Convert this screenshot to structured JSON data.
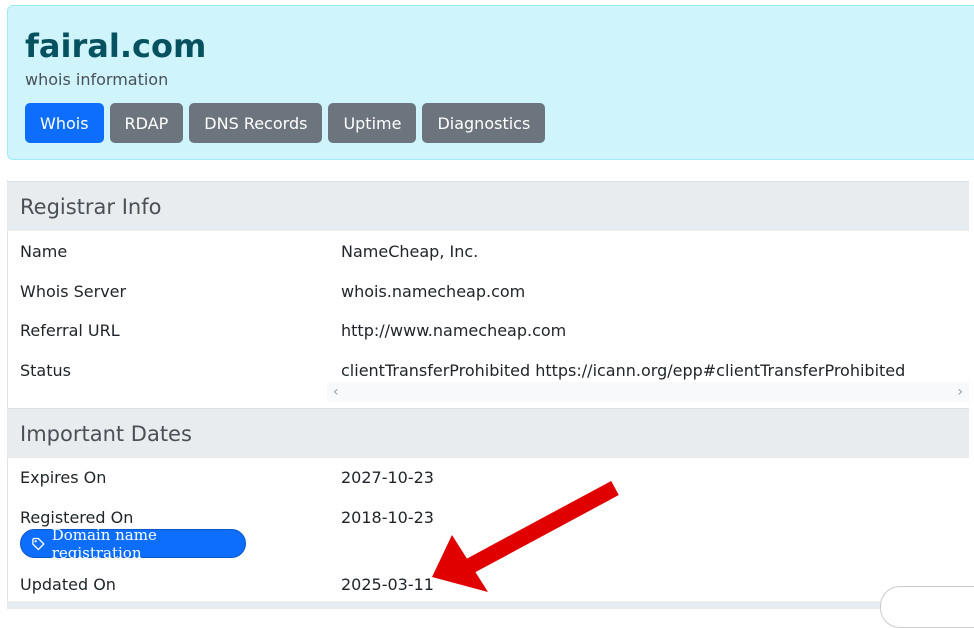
{
  "header": {
    "domain": "fairal.com",
    "subtitle": "whois information",
    "tabs": [
      {
        "label": "Whois",
        "active": true
      },
      {
        "label": "RDAP",
        "active": false
      },
      {
        "label": "DNS Records",
        "active": false
      },
      {
        "label": "Uptime",
        "active": false
      },
      {
        "label": "Diagnostics",
        "active": false
      }
    ]
  },
  "registrar": {
    "heading": "Registrar Info",
    "rows": [
      {
        "label": "Name",
        "value": "NameCheap, Inc."
      },
      {
        "label": "Whois Server",
        "value": "whois.namecheap.com"
      },
      {
        "label": "Referral URL",
        "value": "http://www.namecheap.com"
      },
      {
        "label": "Status",
        "value": "clientTransferProhibited https://icann.org/epp#clientTransferProhibited"
      }
    ]
  },
  "dates": {
    "heading": "Important Dates",
    "rows": [
      {
        "label": "Expires On",
        "value": "2027-10-23"
      },
      {
        "label": "Registered On",
        "value": "2018-10-23"
      },
      {
        "label": "Updated On",
        "value": "2025-03-11"
      }
    ],
    "badge": {
      "label": "Domain name registration",
      "icon": "tag-icon"
    }
  },
  "colors": {
    "accent": "#0d6efd",
    "secondary": "#6c757d",
    "hero_bg": "#cff4fc",
    "annotation_arrow": "#e00000"
  }
}
